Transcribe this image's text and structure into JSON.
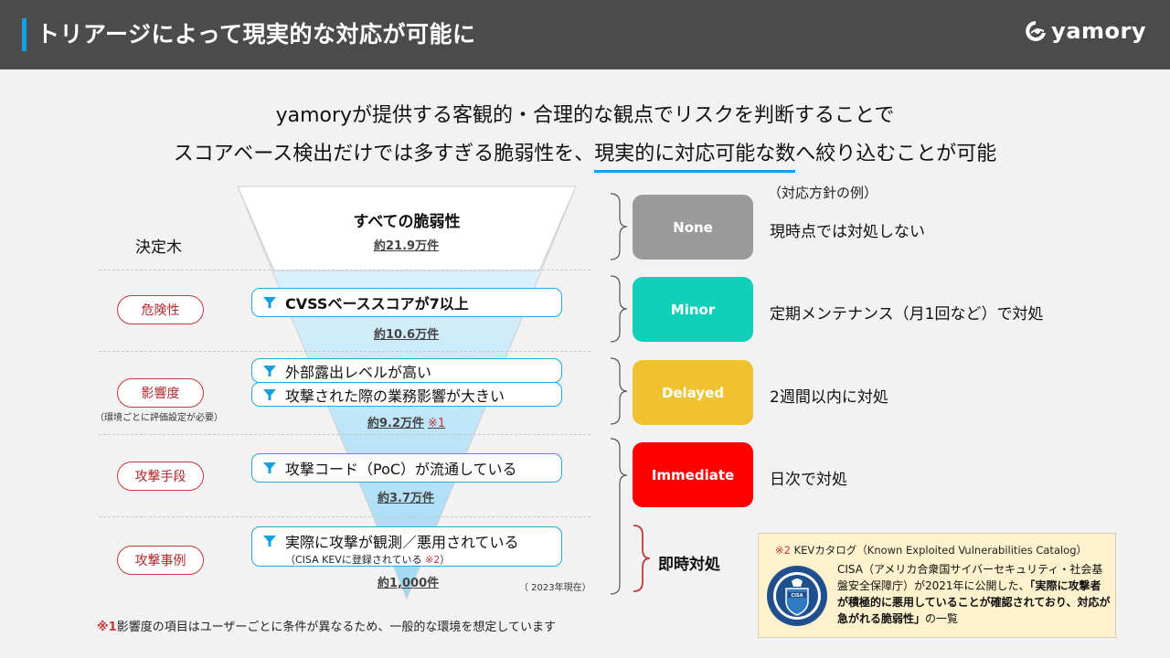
{
  "header": {
    "title": "トリアージによって現実的な対応が可能に",
    "logo_text": "yamory",
    "accent_color": "#13a0e3"
  },
  "lead": {
    "line1": "yamoryが提供する客観的・合理的な観点でリスクを判断することで",
    "line2_pre": "スコアベース検出だけでは多すぎる脆弱性を、",
    "line2_highlight": "現実的に対応可能な数",
    "line2_post": "へ絞り込むことが可能"
  },
  "decision_tree": {
    "label": "決定木",
    "top": {
      "title": "すべての脆弱性",
      "count": "約21.9万件"
    },
    "stages": [
      {
        "category": "危険性",
        "category_note": "",
        "filters": [
          {
            "text": "CVSSベーススコアが7以上"
          }
        ],
        "count": "約10.6万件",
        "count_note": ""
      },
      {
        "category": "影響度",
        "category_note": "（環境ごとに評価設定が必要）",
        "filters": [
          {
            "text": "外部露出レベルが高い"
          },
          {
            "text": "攻撃された際の業務影響が大きい"
          }
        ],
        "count": "約9.2万件",
        "count_note": "※1"
      },
      {
        "category": "攻撃手段",
        "category_note": "",
        "filters": [
          {
            "text": "攻撃コード（PoC）が流通している"
          }
        ],
        "count": "約3.7万件",
        "count_note": ""
      },
      {
        "category": "攻撃事例",
        "category_note": "",
        "filters": [
          {
            "text": "実際に攻撃が観測／悪用されている",
            "sub": "（CISA KEVに登録されている",
            "sub_note": "※2",
            "sub_close": "）"
          }
        ],
        "count": "約1,000件",
        "count_note": ""
      }
    ],
    "year_note": "（ 2023年現在）"
  },
  "policies": {
    "heading": "（対応方針の例）",
    "items": [
      {
        "badge": "None",
        "color": "#9b9b9b",
        "text": "現時点では対処しない"
      },
      {
        "badge": "Minor",
        "color": "#11d0b8",
        "text": "定期メンテナンス（月1回など）で対処"
      },
      {
        "badge": "Delayed",
        "color": "#f0c232",
        "text": "2週間以内に対処"
      },
      {
        "badge": "Immediate",
        "color": "#ff0000",
        "text": "日次で対処"
      }
    ],
    "immediate_label": "即時対処"
  },
  "footnote1": {
    "mark": "※1",
    "text": "影響度の項目はユーザーごとに条件が異なるため、一般的な環境を想定しています"
  },
  "kev_box": {
    "mark": "※2",
    "title": "KEVカタログ（Known Exploited Vulnerabilities Catalog）",
    "body_pre": "CISA（アメリカ合衆国サイバーセキュリティ・社会基盤安全保障庁）が2021年に公開した、",
    "body_bold": "「実際に攻撃者が積極的に悪用していることが確認されており、対応が急がれる脆弱性」",
    "body_post": "の一覧",
    "seal_text": "CISA"
  }
}
